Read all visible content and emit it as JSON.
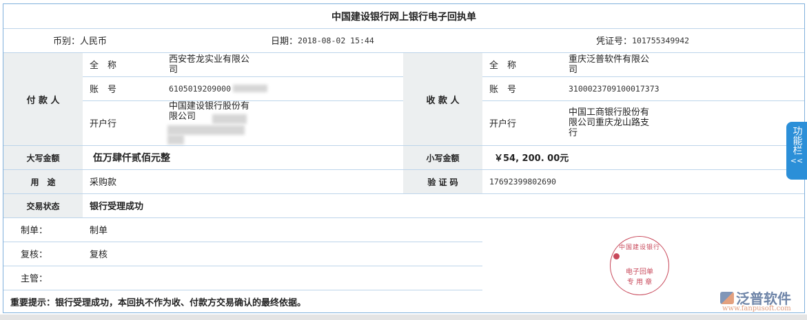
{
  "title": "中国建设银行网上银行电子回执单",
  "info": {
    "currency_label": "币别：",
    "currency": "人民币",
    "date_label": "日期：",
    "date": "2018-08-02 15:44",
    "voucher_label": "凭证号：",
    "voucher": "101755349942"
  },
  "payer": {
    "header": "付 款 人",
    "name_label": "全　称",
    "name": "西安苍龙实业有限公司",
    "account_label": "账　号",
    "account": "6105019209000",
    "bank_label": "开户行",
    "bank": "中国建设银行股份有限公司"
  },
  "payee": {
    "header": "收 款 人",
    "name_label": "全　称",
    "name": "重庆泛普软件有限公司",
    "account_label": "账　号",
    "account": "3100023709100017373",
    "bank_label": "开户行",
    "bank": "中国工商银行股份有限公司重庆龙山路支行"
  },
  "amount_upper_label": "大写金额",
  "amount_upper": "伍万肆仟贰佰元整",
  "amount_lower_label": "小写金额",
  "amount_lower": "￥54, 200. 00元",
  "purpose_label": "用　途",
  "purpose": "采购款",
  "verify_label": "验 证 码",
  "verify": "17692399802690",
  "status_label": "交易状态",
  "status": "银行受理成功",
  "maker_label": "制单：",
  "maker": "制单",
  "checker_label": "复核：",
  "checker": "复核",
  "supervisor_label": "主管：",
  "supervisor": "",
  "notice": "重要提示：银行受理成功，本回执不作为收、付款方交易确认的最终依据。",
  "stamp": {
    "ring": "中国建设银行",
    "line1": "电子回单",
    "line2": "专 用 章"
  },
  "watermark": {
    "brand": "泛普软件",
    "url": "www.fanpusoft.com"
  },
  "side_panel": {
    "label": "功能栏",
    "arrow": "<<"
  },
  "colors": {
    "border": "#7fb0dc",
    "header_bg": "#eceff0",
    "stamp": "#c8485a",
    "side": "#2b8fd8"
  }
}
